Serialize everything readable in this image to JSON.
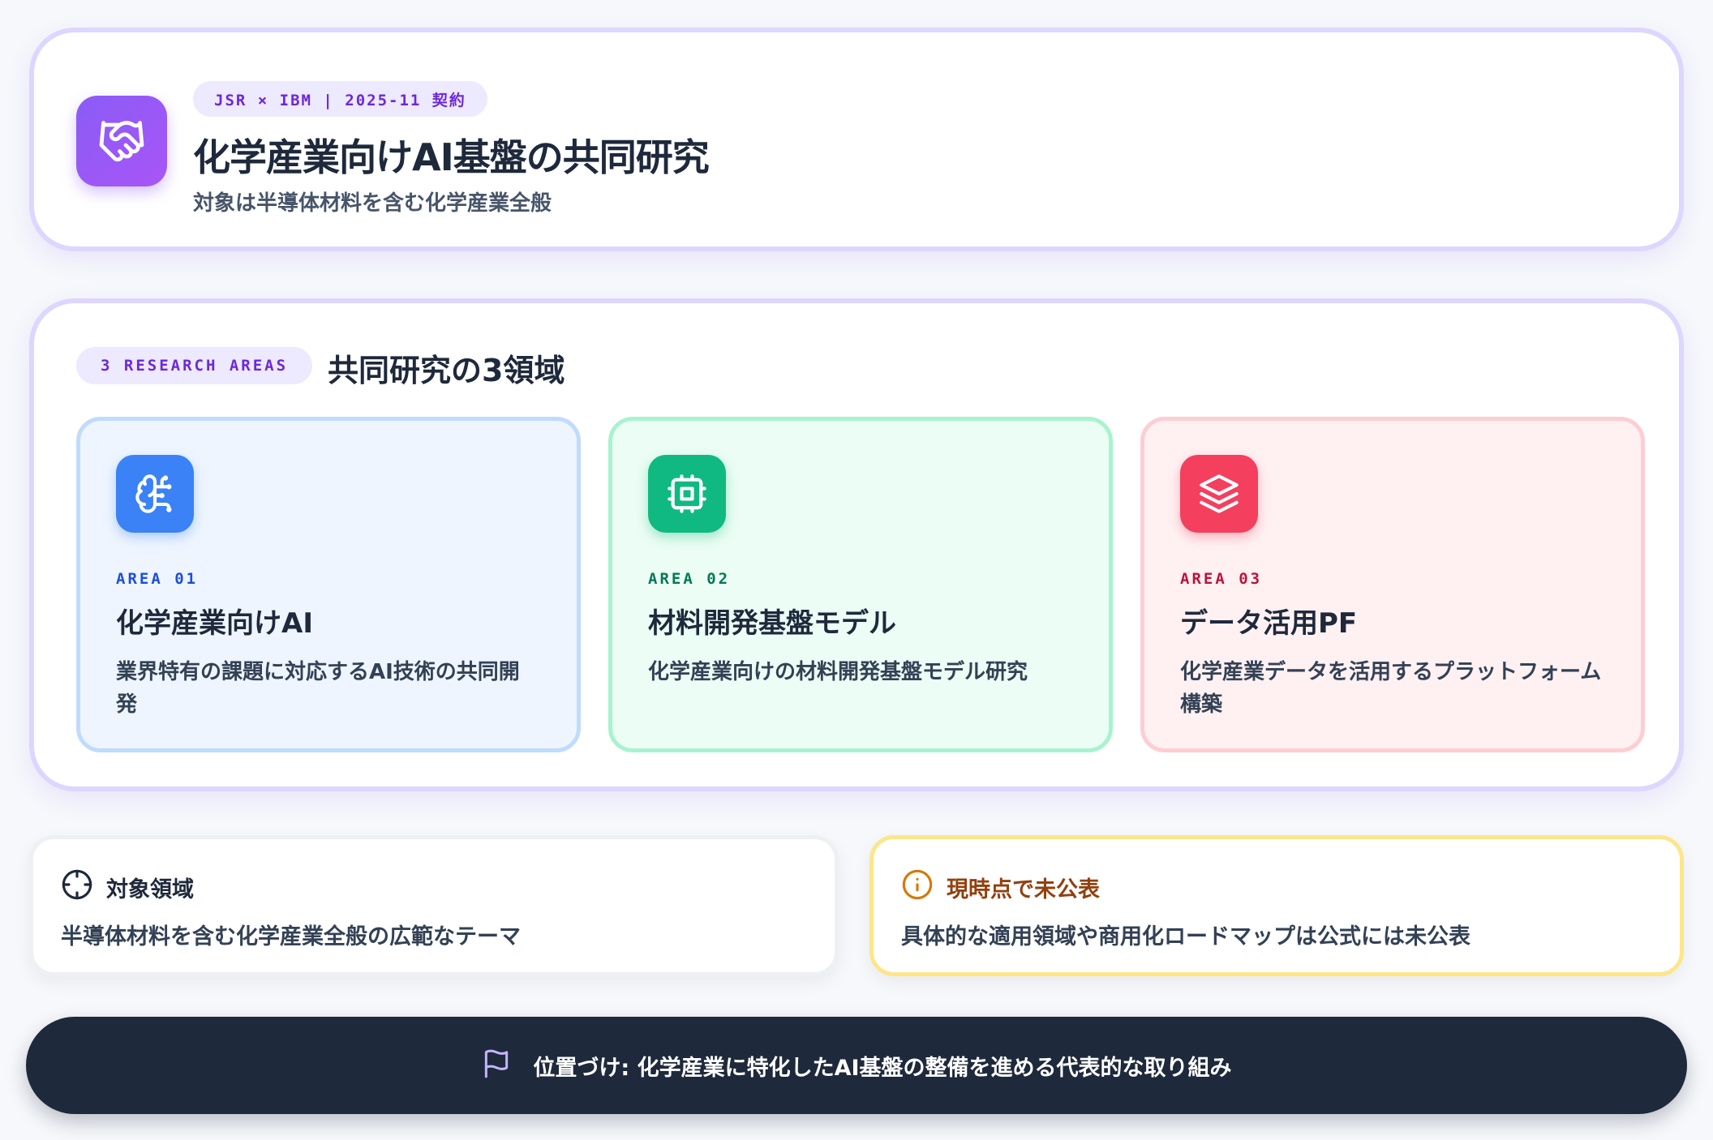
{
  "header": {
    "badge": "JSR × IBM | 2025-11 契約",
    "title": "化学産業向けAI基盤の共同研究",
    "subtitle": "対象は半導体材料を含む化学産業全般",
    "icon": "handshake-icon"
  },
  "areas_section": {
    "badge": "3 RESEARCH AREAS",
    "title": "共同研究の3領域",
    "items": [
      {
        "label": "AREA 01",
        "title": "化学産業向けAI",
        "description": "業界特有の課題に対応するAI技術の共同開発",
        "icon": "brain-icon",
        "color": "#3b82f6"
      },
      {
        "label": "AREA 02",
        "title": "材料開発基盤モデル",
        "description": "化学産業向けの材料開発基盤モデル研究",
        "icon": "cpu-chip-icon",
        "color": "#10b981"
      },
      {
        "label": "AREA 03",
        "title": "データ活用PF",
        "description": "化学産業データを活用するプラットフォーム構築",
        "icon": "layers-icon",
        "color": "#f43f5e"
      }
    ]
  },
  "scope": {
    "title": "対象領域",
    "text": "半導体材料を含む化学産業全般の広範なテーマ",
    "icon": "target-icon"
  },
  "unpublished": {
    "title": "現時点で未公表",
    "text": "具体的な適用領域や商用化ロードマップは公式には未公表",
    "icon": "info-icon",
    "color": "#d97706"
  },
  "footer": {
    "text": "位置づけ: 化学産業に特化したAI基盤の整備を進める代表的な取り組み",
    "icon": "flag-icon"
  },
  "colors": {
    "accent": "#8b5cf6",
    "dark": "#1e293b"
  }
}
